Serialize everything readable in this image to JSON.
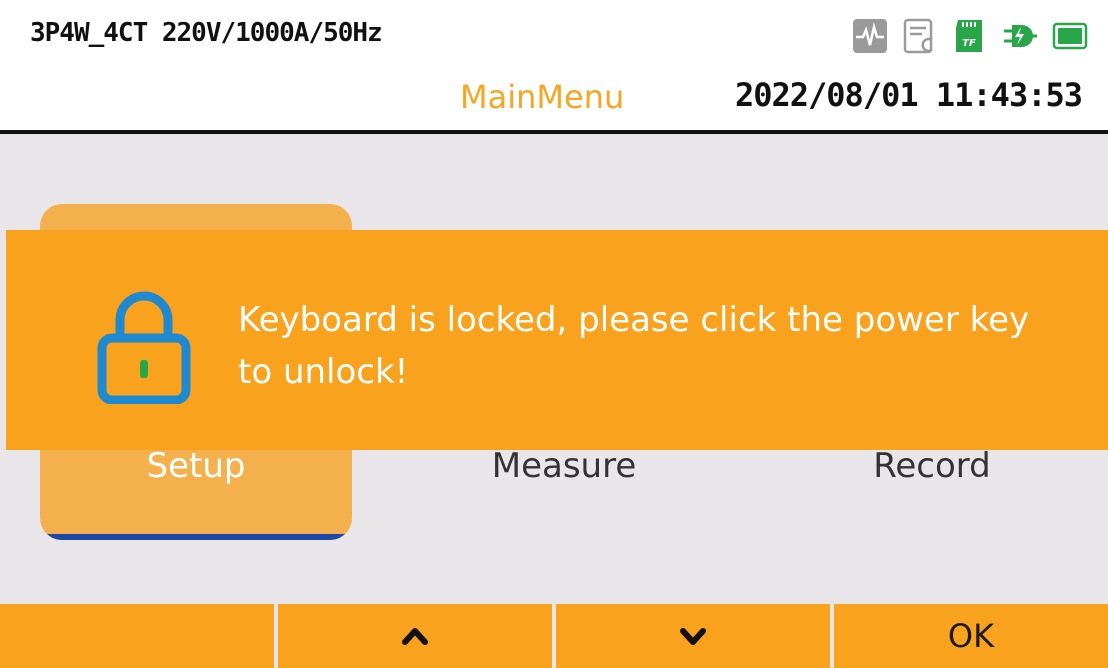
{
  "header": {
    "config": "3P4W_4CT 220V/1000A/50Hz",
    "title": "MainMenu",
    "datetime": "2022/08/01 11:43:53",
    "status_icons": [
      "waveform-icon",
      "report-icon",
      "tf-card-icon",
      "power-plug-icon",
      "battery-icon"
    ]
  },
  "menu": {
    "items": [
      {
        "label": "Setup",
        "selected": true
      },
      {
        "label": "Measure",
        "selected": false
      },
      {
        "label": "Record",
        "selected": false
      }
    ]
  },
  "lock_banner": {
    "icon": "lock-icon",
    "message": "Keyboard is locked, please click the power key to unlock!"
  },
  "softkeys": [
    {
      "label": "",
      "icon": null
    },
    {
      "label": "",
      "icon": "chevron-up-icon"
    },
    {
      "label": "",
      "icon": "chevron-down-icon"
    },
    {
      "label": "OK",
      "icon": null
    }
  ],
  "colors": {
    "accent": "#f8a21e",
    "selected_card": "#f3b04d",
    "selection_underline": "#1f47a8",
    "title": "#f5a623",
    "background": "#e9e6e9"
  }
}
